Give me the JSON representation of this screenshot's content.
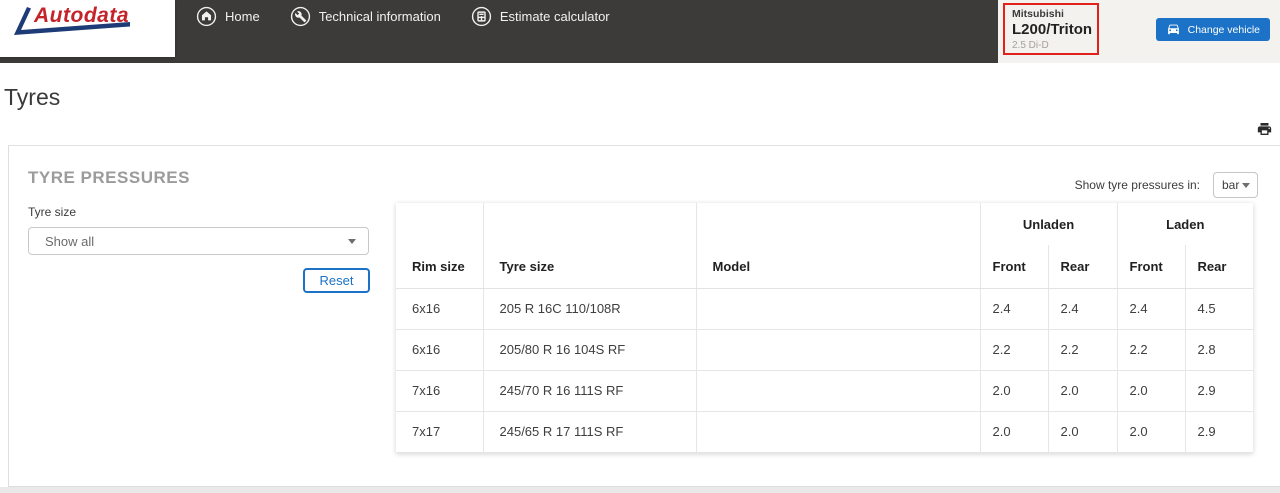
{
  "header": {
    "logo_text": "Autodata",
    "nav": [
      {
        "label": "Home",
        "icon": "home-icon"
      },
      {
        "label": "Technical information",
        "icon": "wrench-icon"
      },
      {
        "label": "Estimate calculator",
        "icon": "calculator-icon"
      }
    ],
    "vehicle": {
      "make": "Mitsubishi",
      "model": "L200/Triton",
      "engine": "2.5 Di-D"
    },
    "change_vehicle_label": "Change vehicle"
  },
  "page": {
    "title": "Tyres"
  },
  "card": {
    "title": "TYRE PRESSURES",
    "filter_label": "Tyre size",
    "filter_value": "Show all",
    "reset_label": "Reset",
    "units_label": "Show tyre pressures in:",
    "units_value": "bar"
  },
  "table": {
    "group_headers": {
      "unladen": "Unladen",
      "laden": "Laden"
    },
    "columns": [
      "Rim size",
      "Tyre size",
      "Model",
      "Front",
      "Rear",
      "Front",
      "Rear"
    ],
    "rows": [
      {
        "rim_size": "6x16",
        "tyre_size": "205 R 16C 110/108R",
        "model": "",
        "unladen": {
          "front": "2.4",
          "rear": "2.4"
        },
        "laden": {
          "front": "2.4",
          "rear": "4.5"
        }
      },
      {
        "rim_size": "6x16",
        "tyre_size": "205/80 R 16 104S RF",
        "model": "",
        "unladen": {
          "front": "2.2",
          "rear": "2.2"
        },
        "laden": {
          "front": "2.2",
          "rear": "2.8"
        }
      },
      {
        "rim_size": "7x16",
        "tyre_size": "245/70 R 16 111S RF",
        "model": "",
        "unladen": {
          "front": "2.0",
          "rear": "2.0"
        },
        "laden": {
          "front": "2.0",
          "rear": "2.9"
        }
      },
      {
        "rim_size": "7x17",
        "tyre_size": "245/65 R 17 111S RF",
        "model": "",
        "unladen": {
          "front": "2.0",
          "rear": "2.0"
        },
        "laden": {
          "front": "2.0",
          "rear": "2.9"
        }
      }
    ]
  },
  "colors": {
    "header_dark": "#3c3b3a",
    "accent_blue": "#1b72c6",
    "logo_red": "#c4232a",
    "logo_swoosh_blue": "#1d3c77",
    "vehicle_border_red": "#e3211c"
  }
}
